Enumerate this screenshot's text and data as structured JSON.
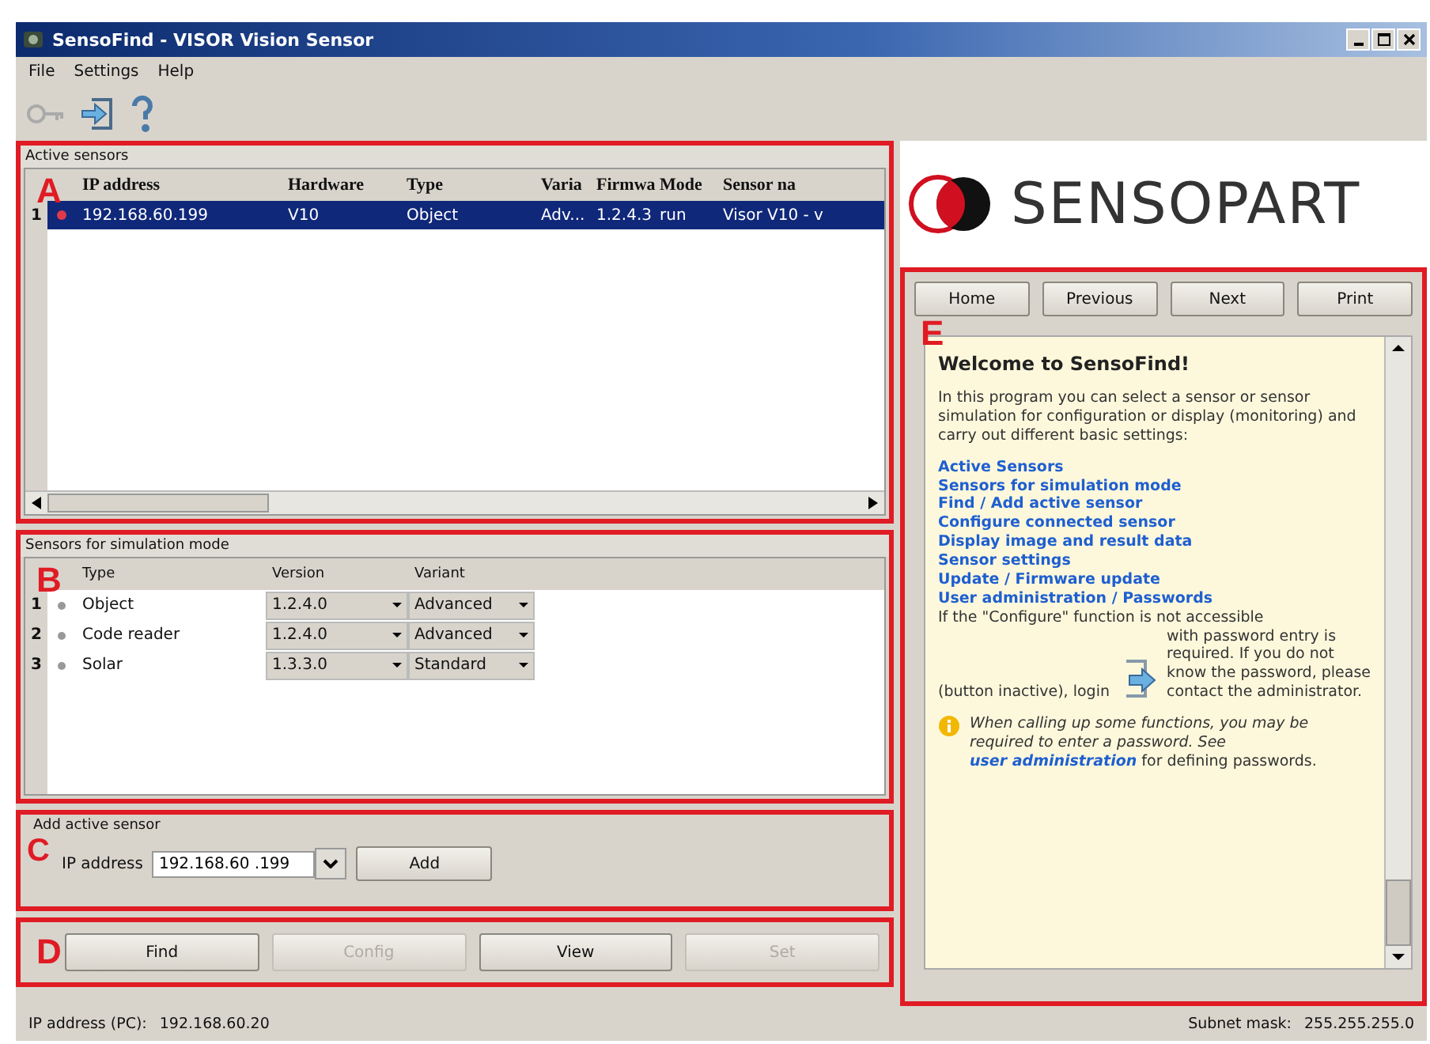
{
  "window": {
    "title": "SensoFind - VISOR Vision Sensor"
  },
  "menu": [
    "File",
    "Settings",
    "Help"
  ],
  "active_sensors": {
    "title": "Active sensors",
    "callout": "A",
    "columns": [
      "IP address",
      "Hardware",
      "Type",
      "Varia",
      "Firmwa",
      "Mode",
      "Sensor na"
    ],
    "rows": [
      {
        "number": "1",
        "selected": true,
        "cells": [
          "192.168.60.199",
          "V10",
          "Object",
          "Adv...",
          "1.2.4.3",
          "run",
          "Visor V10 - v"
        ]
      }
    ]
  },
  "simulation": {
    "title": "Sensors for simulation mode",
    "callout": "B",
    "columns": [
      "Type",
      "Version",
      "Variant"
    ],
    "rows": [
      {
        "number": "1",
        "type": "Object",
        "version": "1.2.4.0",
        "variant": "Advanced"
      },
      {
        "number": "2",
        "type": "Code reader",
        "version": "1.2.4.0",
        "variant": "Advanced"
      },
      {
        "number": "3",
        "type": "Solar",
        "version": "1.3.3.0",
        "variant": "Standard"
      }
    ]
  },
  "add_sensor": {
    "title": "Add active sensor",
    "callout": "C",
    "label": "IP address",
    "value": "192.168.60 .199",
    "button": "Add"
  },
  "actions": {
    "callout": "D",
    "buttons": [
      {
        "label": "Find",
        "disabled": false
      },
      {
        "label": "Config",
        "disabled": true
      },
      {
        "label": "View",
        "disabled": false
      },
      {
        "label": "Set",
        "disabled": true
      }
    ]
  },
  "logo": {
    "text": "SENSOPART"
  },
  "help": {
    "callout": "E",
    "nav": [
      "Home",
      "Previous",
      "Next",
      "Print"
    ],
    "heading": "Welcome to SensoFind!",
    "intro": "In this program you can select a sensor or sensor simulation for configuration or display (monitoring) and carry out different basic settings:",
    "links": [
      "Active Sensors",
      "Sensors for simulation mode",
      "Find / Add active sensor",
      "Configure connected sensor",
      "Display image and result data",
      "Sensor settings",
      "Update / Firmware update",
      "User administration / Passwords"
    ],
    "configure_text": "If the \"Configure\" function is not accessible",
    "login_text": "(button inactive), login",
    "password_text": "with password entry is required. If you do not know the password, please contact the administrator.",
    "note": "When calling up some functions, you may be required to enter a password. See",
    "note_link": "user administration",
    "note_end": "for defining passwords."
  },
  "status_bar": [
    {
      "label": "IP address (PC):",
      "value": "192.168.60.20"
    },
    {
      "label": "Subnet mask:",
      "value": "255.255.255.0"
    }
  ]
}
